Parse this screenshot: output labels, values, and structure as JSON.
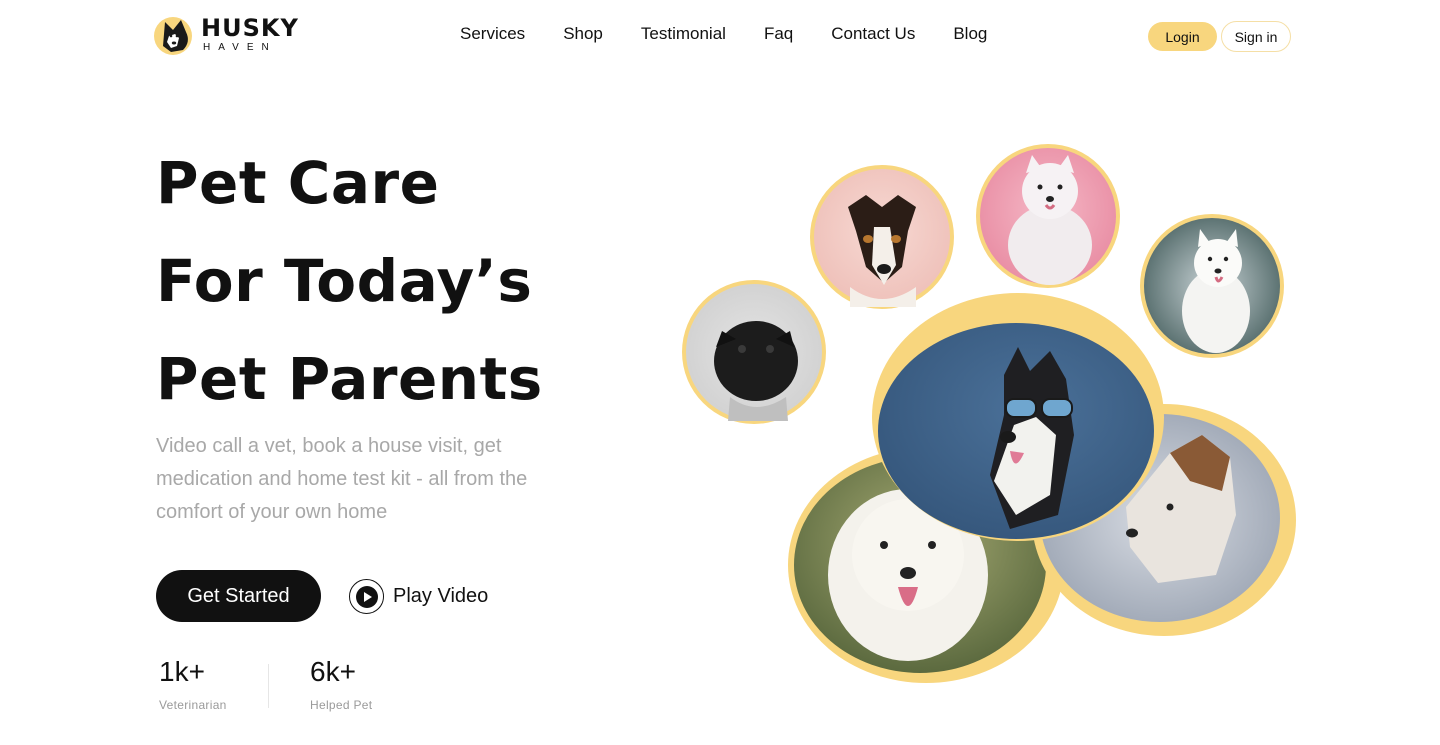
{
  "brand": {
    "name": "HUSKY",
    "tagline": "HAVEN"
  },
  "nav": {
    "items": [
      {
        "label": "Services"
      },
      {
        "label": "Shop"
      },
      {
        "label": "Testimonial"
      },
      {
        "label": "Faq"
      },
      {
        "label": "Contact Us"
      },
      {
        "label": "Blog"
      }
    ]
  },
  "auth": {
    "login_label": "Login",
    "signin_label": "Sign in"
  },
  "hero": {
    "title_lines": [
      "Pet Care",
      "For Today’s",
      "Pet Parents"
    ],
    "description": "Video call a vet, book a house visit, get medication and home test kit - all from the comfort of your own home",
    "cta_label": "Get Started",
    "play_label": "Play Video"
  },
  "stats": [
    {
      "value": "1k+",
      "label": "Veterinarian"
    },
    {
      "value": "6k+",
      "label": "Helped Pet"
    }
  ],
  "colors": {
    "accent": "#f8d67e",
    "dark": "#111111",
    "muted": "#a8a8a8"
  },
  "gallery": {
    "photos": [
      {
        "name": "terrier-photo-circle",
        "subject": "jack russell terrier"
      },
      {
        "name": "samoyed-pink-photo-circle",
        "subject": "white samoyed on pink"
      },
      {
        "name": "samoyed-forest-photo-circle",
        "subject": "white samoyed outdoors"
      },
      {
        "name": "pug-photo-circle",
        "subject": "black pug"
      },
      {
        "name": "husky-sunglasses-photo",
        "subject": "husky wearing sunglasses"
      },
      {
        "name": "samoyed-tongue-photo",
        "subject": "samoyed with tongue out"
      },
      {
        "name": "husky-profile-photo",
        "subject": "husky in snow"
      }
    ]
  }
}
